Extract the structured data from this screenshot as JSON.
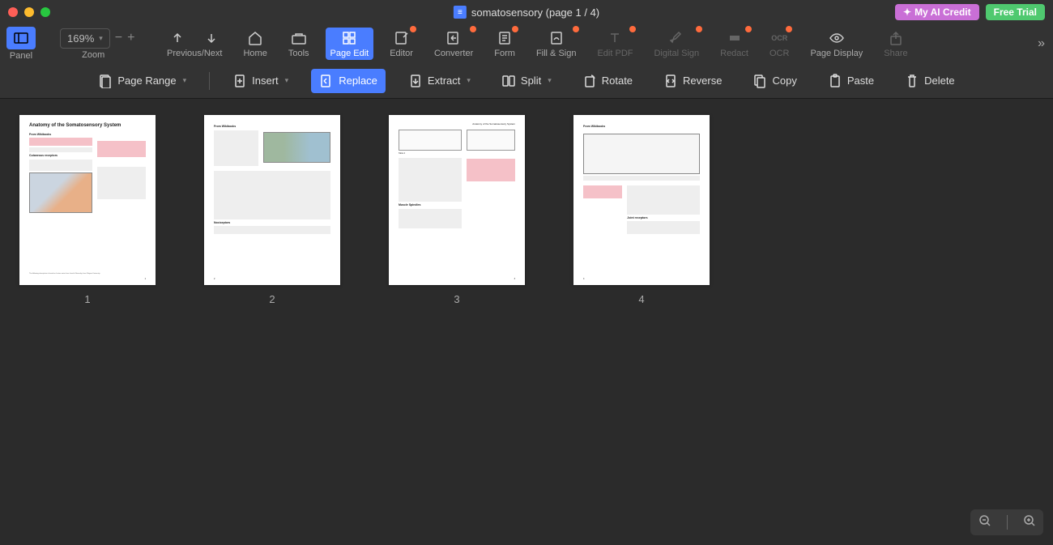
{
  "title": "somatosensory (page 1 / 4)",
  "title_right": {
    "ai_credit": "My AI Credit",
    "free_trial": "Free Trial"
  },
  "toolbar_left": {
    "panel": "Panel",
    "zoom": "Zoom",
    "zoom_value": "169%"
  },
  "main_toolbar": {
    "prev_next": "Previous/Next",
    "home": "Home",
    "tools": "Tools",
    "page_edit": "Page Edit",
    "editor": "Editor",
    "converter": "Converter",
    "form": "Form",
    "fill_sign": "Fill & Sign",
    "edit_pdf": "Edit PDF",
    "digital_sign": "Digital Sign",
    "redact": "Redact",
    "ocr": "OCR",
    "page_display": "Page Display",
    "share": "Share"
  },
  "sub_toolbar": {
    "page_range": "Page Range",
    "insert": "Insert",
    "replace": "Replace",
    "extract": "Extract",
    "split": "Split",
    "rotate": "Rotate",
    "reverse": "Reverse",
    "copy": "Copy",
    "paste": "Paste",
    "delete": "Delete"
  },
  "pages": {
    "nums": [
      "1",
      "2",
      "3",
      "4"
    ],
    "p1_title": "Anatomy of the Somatosensory System",
    "p1_src": "From Wikibooks",
    "p3_header": "Anatomy of the Somatosensory System"
  }
}
